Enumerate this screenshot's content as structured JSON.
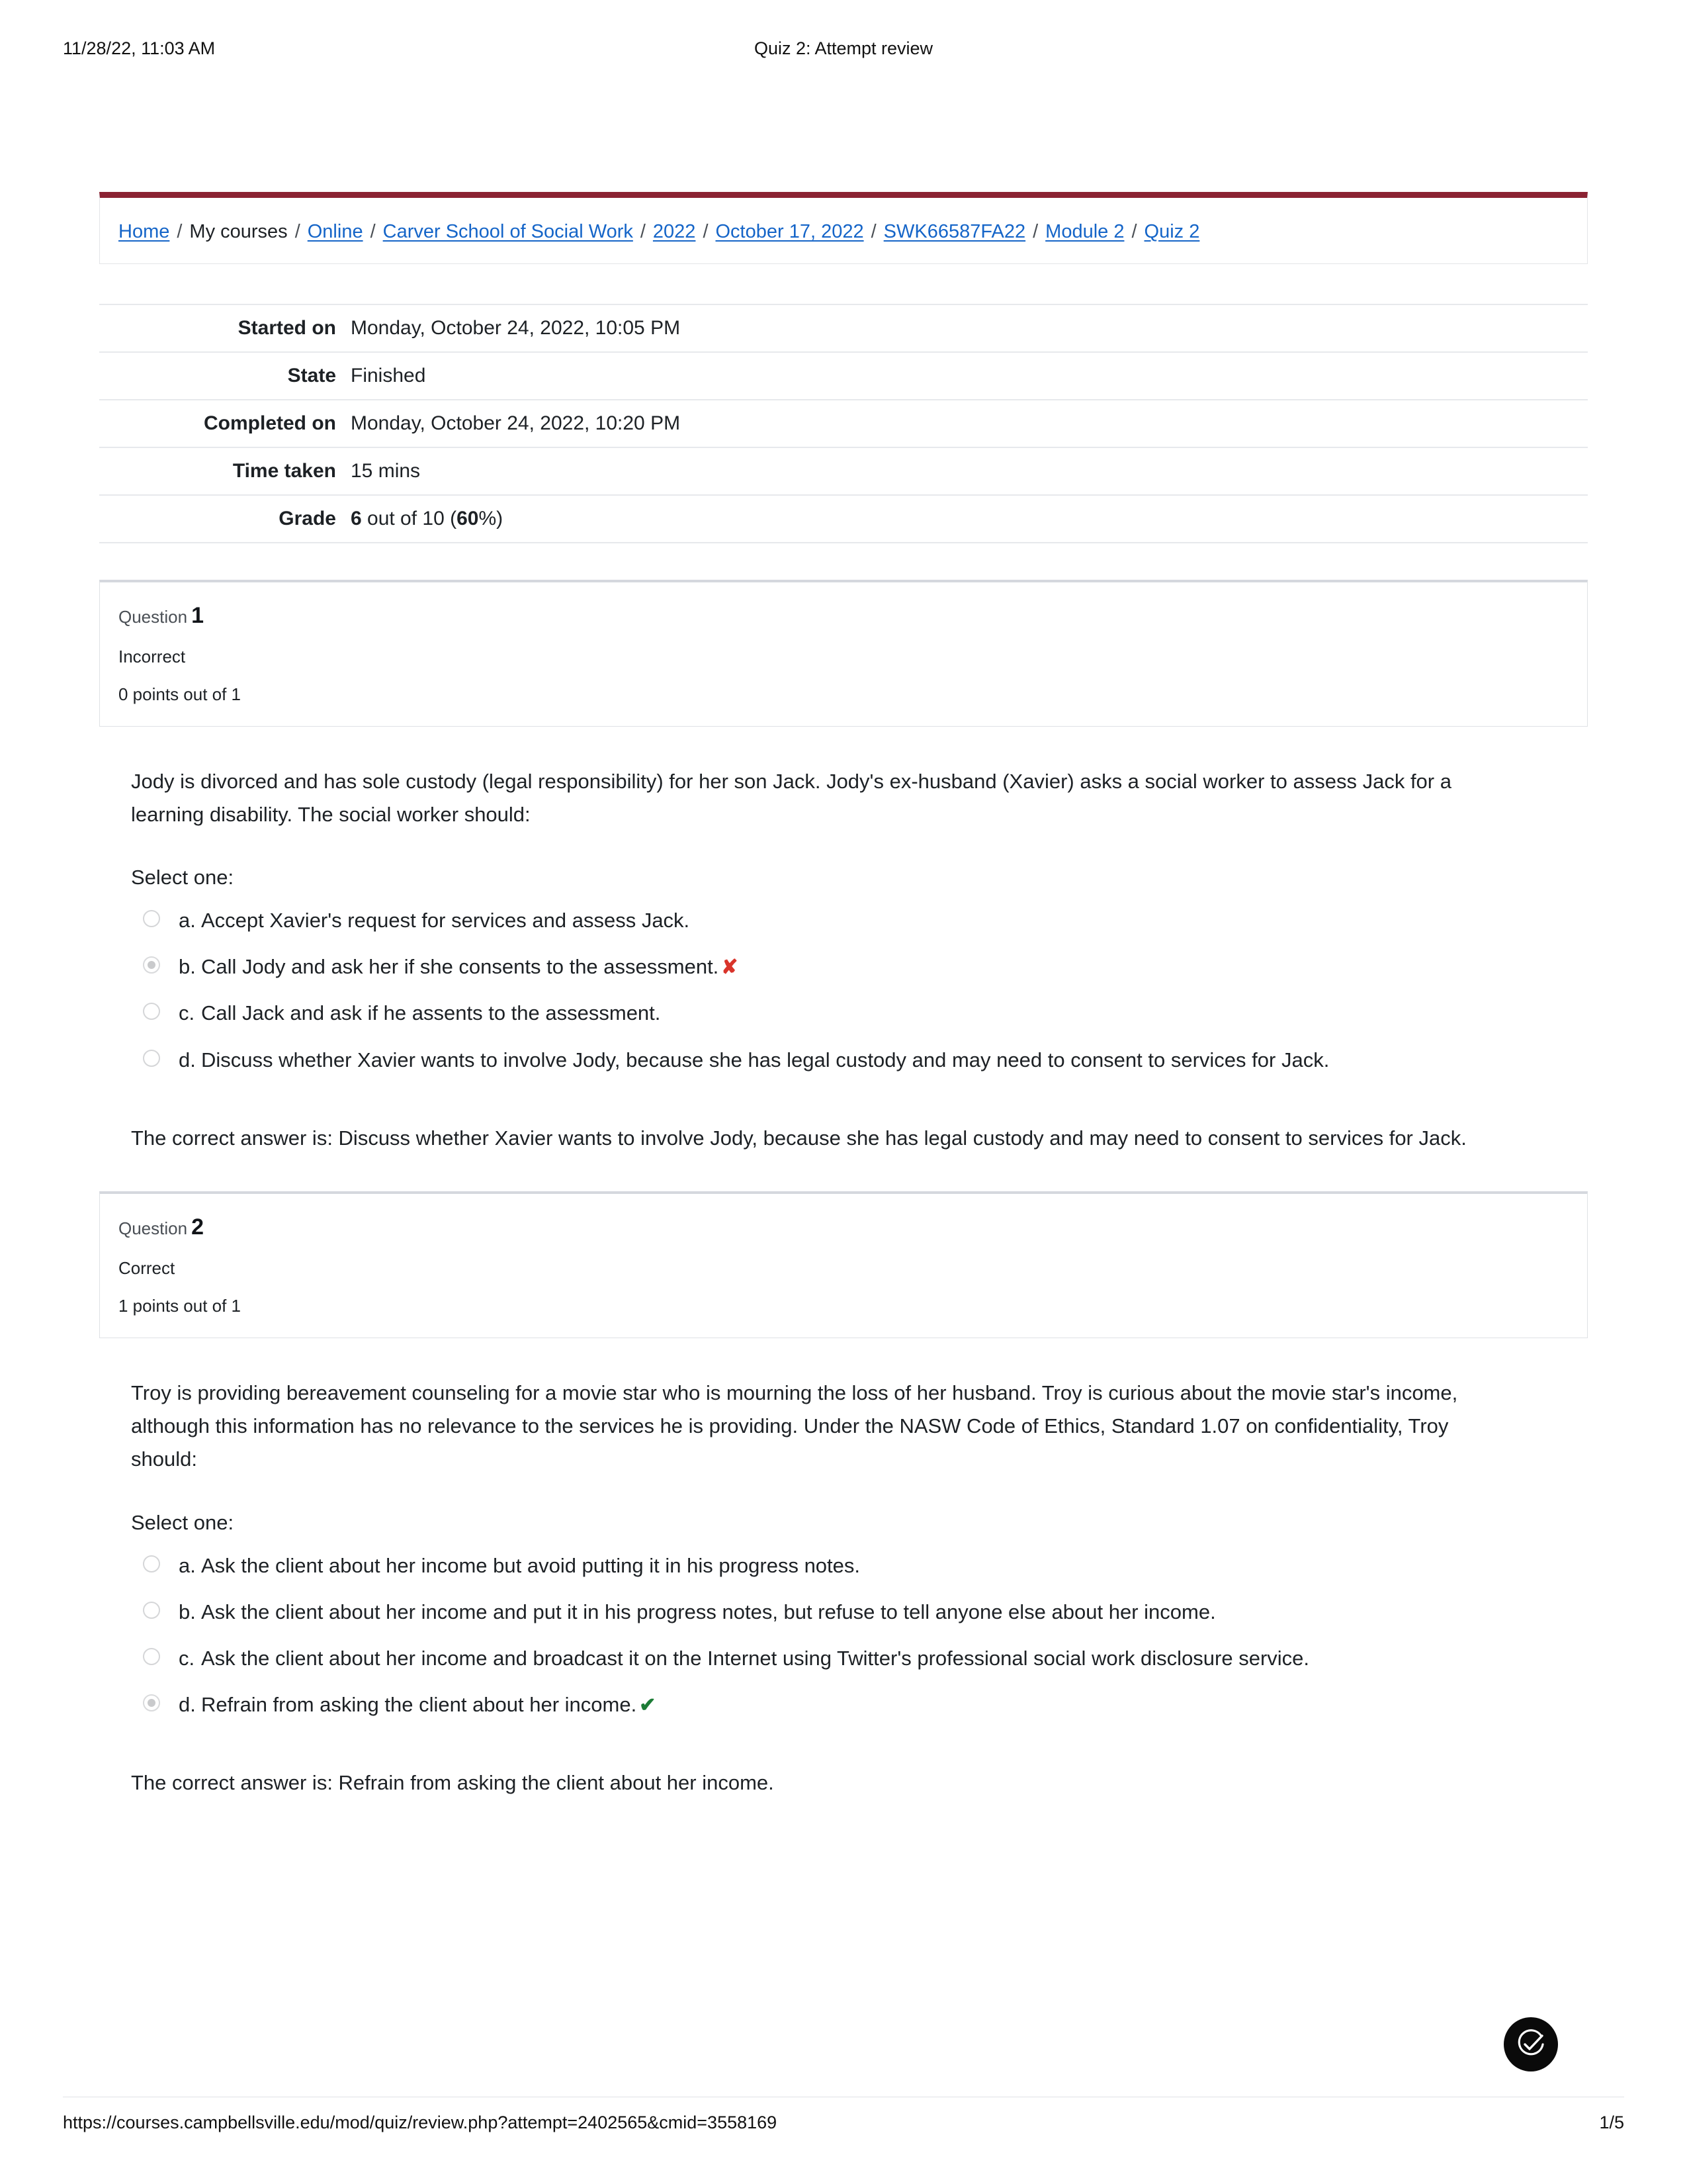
{
  "print_header": {
    "timestamp": "11/28/22, 11:03 AM",
    "title": "Quiz 2: Attempt review"
  },
  "theme": {
    "accent_bar": "#8b2333",
    "link_color": "#1565c8",
    "wrong_color": "#d9342b",
    "correct_color": "#1c7c36"
  },
  "breadcrumb": {
    "separator": "/",
    "items": [
      {
        "label": "Home",
        "is_link": true
      },
      {
        "label": "My courses",
        "is_link": false
      },
      {
        "label": "Online",
        "is_link": true
      },
      {
        "label": "Carver School of Social Work",
        "is_link": true
      },
      {
        "label": "2022",
        "is_link": true
      },
      {
        "label": "October 17, 2022",
        "is_link": true
      },
      {
        "label": "SWK66587FA22",
        "is_link": true
      },
      {
        "label": "Module 2",
        "is_link": true
      },
      {
        "label": "Quiz 2",
        "is_link": true
      }
    ]
  },
  "attempt_info": {
    "rows": [
      {
        "label": "Started on",
        "value": "Monday, October 24, 2022, 10:05 PM"
      },
      {
        "label": "State",
        "value": "Finished"
      },
      {
        "label": "Completed on",
        "value": "Monday, October 24, 2022, 10:20 PM"
      },
      {
        "label": "Time taken",
        "value": "15 mins"
      }
    ],
    "grade": {
      "label": "Grade",
      "score": "6",
      "middle": " out of 10 (",
      "percent": "60",
      "suffix": "%)"
    }
  },
  "questions": [
    {
      "number_label": "Question",
      "number": "1",
      "state": "Incorrect",
      "points": "0 points out of 1",
      "text": "Jody is divorced and has sole custody (legal responsibility) for her son Jack. Jody's ex-husband (Xavier) asks a social worker to assess Jack for a learning disability. The social worker should:",
      "select_prompt": "Select one:",
      "options": [
        {
          "key": "a.",
          "text": "Accept Xavier's request for services and assess Jack.",
          "selected": false,
          "mark": ""
        },
        {
          "key": "b.",
          "text": "Call Jody and ask her if she consents to the assessment.",
          "selected": true,
          "mark": "✘"
        },
        {
          "key": "c.",
          "text": "Call Jack and ask if he assents to the assessment.",
          "selected": false,
          "mark": ""
        },
        {
          "key": "d.",
          "text": "Discuss whether Xavier wants to involve Jody, because she has legal custody and may need to consent to services for Jack.",
          "selected": false,
          "mark": ""
        }
      ],
      "feedback": "The correct answer is: Discuss whether Xavier wants to involve Jody, because she has legal custody and may need to consent to services for Jack."
    },
    {
      "number_label": "Question",
      "number": "2",
      "state": "Correct",
      "points": "1 points out of 1",
      "text": "Troy is providing bereavement counseling for a movie star who is mourning the loss of her husband. Troy is curious about the movie star's income, although this information has no relevance to the services he is providing. Under the NASW Code of Ethics, Standard 1.07 on confidentiality, Troy should:",
      "select_prompt": "Select one:",
      "options": [
        {
          "key": "a.",
          "text": "Ask the client about her income but avoid putting it in his progress notes.",
          "selected": false,
          "mark": ""
        },
        {
          "key": "b.",
          "text": "Ask the client about her income and put it in his progress notes, but refuse to tell anyone else about her income.",
          "selected": false,
          "mark": ""
        },
        {
          "key": "c.",
          "text": "Ask the client about her income and broadcast it on the Internet using Twitter's professional social work disclosure service.",
          "selected": false,
          "mark": ""
        },
        {
          "key": "d.",
          "text": "Refrain from asking the client about her income.",
          "selected": true,
          "mark": "✔"
        }
      ],
      "feedback": "The correct answer is: Refrain from asking the client about her income."
    }
  ],
  "print_footer": {
    "url": "https://courses.campbellsville.edu/mod/quiz/review.php?attempt=2402565&cmid=3558169",
    "page": "1/5"
  }
}
